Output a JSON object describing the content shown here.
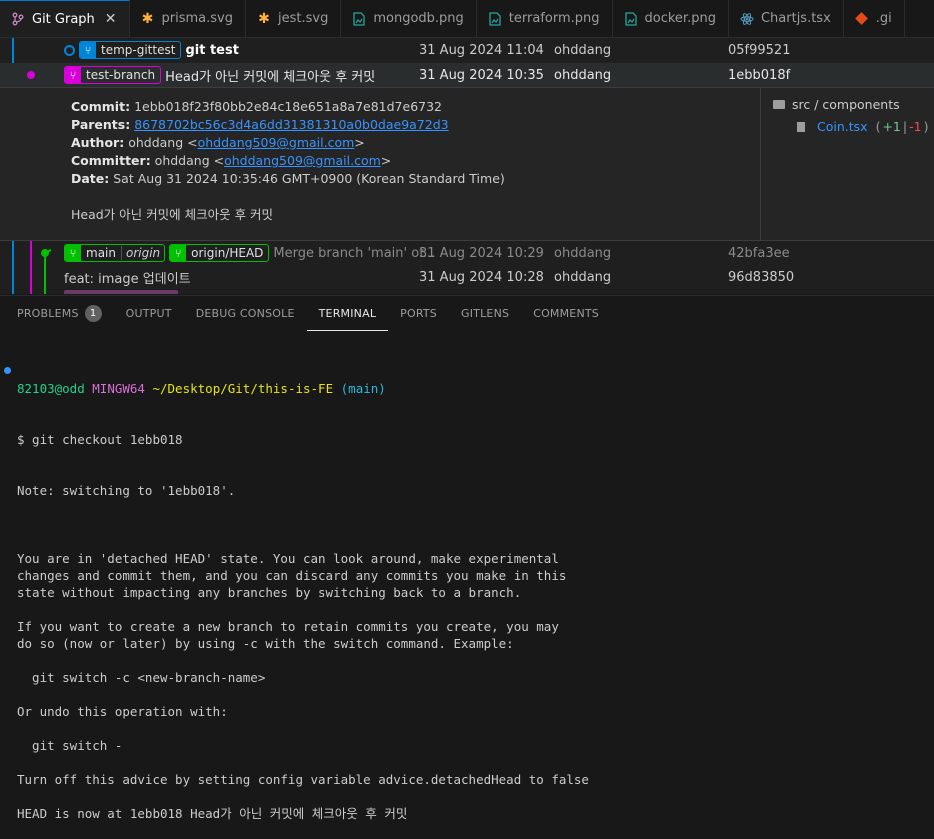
{
  "tabs": [
    {
      "label": "Git Graph",
      "icon": "git-graph-icon",
      "active": true,
      "close": "✕"
    },
    {
      "label": "prisma.svg",
      "icon": "svg-icon"
    },
    {
      "label": "jest.svg",
      "icon": "svg-icon"
    },
    {
      "label": "mongodb.png",
      "icon": "image-icon"
    },
    {
      "label": "terraform.png",
      "icon": "image-icon"
    },
    {
      "label": "docker.png",
      "icon": "image-icon"
    },
    {
      "label": "Chartjs.tsx",
      "icon": "react-icon"
    },
    {
      "label": ".gi",
      "icon": "git-icon"
    }
  ],
  "commits": [
    {
      "refs": [
        {
          "name": "temp-gittest",
          "color": "#0085d9"
        }
      ],
      "message": "git test",
      "date": "31 Aug 2024 11:04",
      "author": "ohddang",
      "hash": "05f99521"
    },
    {
      "refs": [
        {
          "name": "test-branch",
          "color": "#d900d9"
        }
      ],
      "message": "Head가 아닌 커밋에 체크아웃 후 커밋",
      "date": "31 Aug 2024 10:35",
      "author": "ohddang",
      "hash": "1ebb018f"
    },
    {
      "refs": [
        {
          "name": "main",
          "sub": "origin",
          "color": "#00c000"
        },
        {
          "name": "origin/HEAD",
          "color": "#00c000"
        }
      ],
      "message": "Merge branch 'main' of...",
      "date": "31 Aug 2024 10:29",
      "author": "ohddang",
      "hash": "42bfa3ee"
    },
    {
      "refs": [],
      "message": "feat: image 업데이트",
      "date": "31 Aug 2024 10:28",
      "author": "ohddang",
      "hash": "96d83850"
    }
  ],
  "details": {
    "commit_label": "Commit:",
    "commit": "1ebb018f23f80bb2e84c18e651a8a7e81d7e6732",
    "parents_label": "Parents:",
    "parents": "8678702bc56c3d4a6dd31381310a0b0dae9a72d3",
    "author_label": "Author:",
    "author": "ohddang <",
    "author_email": "ohddang509@gmail.com",
    "author_end": ">",
    "committer_label": "Committer:",
    "committer": "ohddang <",
    "committer_email": "ohddang509@gmail.com",
    "committer_end": ">",
    "date_label": "Date:",
    "date": "Sat Aug 31 2024 10:35:46 GMT+0900 (Korean Standard Time)",
    "message": "Head가 아닌 커밋에 체크아웃 후 커밋",
    "folder": "src / components",
    "file": "Coin.tsx",
    "file_add": "+1",
    "file_sep": "|",
    "file_del": "-1"
  },
  "panel_tabs": [
    {
      "label": "PROBLEMS",
      "badge": "1"
    },
    {
      "label": "OUTPUT"
    },
    {
      "label": "DEBUG CONSOLE"
    },
    {
      "label": "TERMINAL",
      "active": true
    },
    {
      "label": "PORTS"
    },
    {
      "label": "GITLENS"
    },
    {
      "label": "COMMENTS"
    }
  ],
  "terminal": {
    "prompt_user": "82103@odd",
    "prompt_env": "MINGW64",
    "prompt_path": "~/Desktop/Git/this-is-FE",
    "prompt_branch": "(main)",
    "command": "$ git checkout 1ebb018",
    "output": [
      "Note: switching to '1ebb018'.",
      "",
      "",
      "",
      "You are in 'detached HEAD' state. You can look around, make experimental",
      "changes and commit them, and you can discard any commits you make in this",
      "state without impacting any branches by switching back to a branch.",
      "",
      "If you want to create a new branch to retain commits you create, you may",
      "do so (now or later) by using -c with the switch command. Example:",
      "",
      "  git switch -c <new-branch-name>",
      "",
      "Or undo this operation with:",
      "",
      "  git switch -",
      "",
      "Turn off this advice by setting config variable advice.detachedHead to false",
      "",
      "HEAD is now at 1ebb018 Head가 아닌 커밋에 체크아웃 후 커밋"
    ]
  },
  "colors": {
    "accent": "#0078d4",
    "blue": "#0085d9",
    "magenta": "#d900d9",
    "green": "#00c000"
  }
}
